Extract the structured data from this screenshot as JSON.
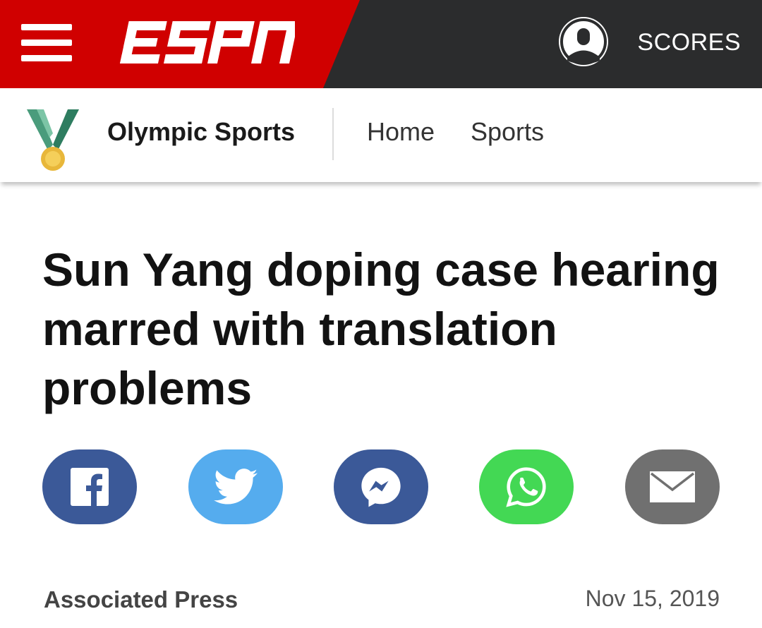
{
  "colors": {
    "espn_red": "#d00000",
    "topbar_dark": "#2b2c2d",
    "facebook": "#3b5998",
    "twitter": "#55acee",
    "messenger": "#3b5998",
    "whatsapp": "#43d854",
    "email": "#707070"
  },
  "header": {
    "logo_icon": "espn-logo",
    "menu_icon": "hamburger-menu-icon",
    "user_icon": "user-profile-icon",
    "scores_label": "SCORES"
  },
  "subnav": {
    "section_icon": "olympic-medal-icon",
    "section_title": "Olympic Sports",
    "links": [
      {
        "label": "Home"
      },
      {
        "label": "Sports"
      }
    ]
  },
  "article": {
    "headline": "Sun Yang doping case hearing marred with translation problems",
    "byline": "Associated Press",
    "date": "Nov 15, 2019"
  },
  "share": [
    {
      "icon": "facebook-icon"
    },
    {
      "icon": "twitter-icon"
    },
    {
      "icon": "messenger-icon"
    },
    {
      "icon": "whatsapp-icon"
    },
    {
      "icon": "email-icon"
    }
  ]
}
